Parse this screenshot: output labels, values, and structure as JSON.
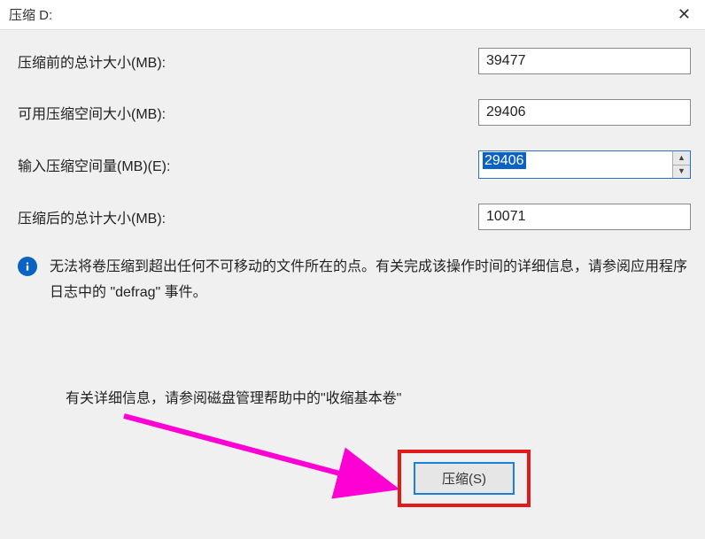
{
  "dialog": {
    "title": "压缩 D:",
    "close": "✕"
  },
  "fields": {
    "total_before_label": "压缩前的总计大小(MB):",
    "total_before_value": "39477",
    "available_label": "可用压缩空间大小(MB):",
    "available_value": "29406",
    "input_label": "输入压缩空间量(MB)(E):",
    "input_value": "29406",
    "total_after_label": "压缩后的总计大小(MB):",
    "total_after_value": "10071"
  },
  "info": {
    "text": "无法将卷压缩到超出任何不可移动的文件所在的点。有关完成该操作时间的详细信息，请参阅应用程序日志中的 \"defrag\" 事件。"
  },
  "more_info": "有关详细信息，请参阅磁盘管理帮助中的\"收缩基本卷\"",
  "buttons": {
    "shrink": "压缩(S)"
  }
}
